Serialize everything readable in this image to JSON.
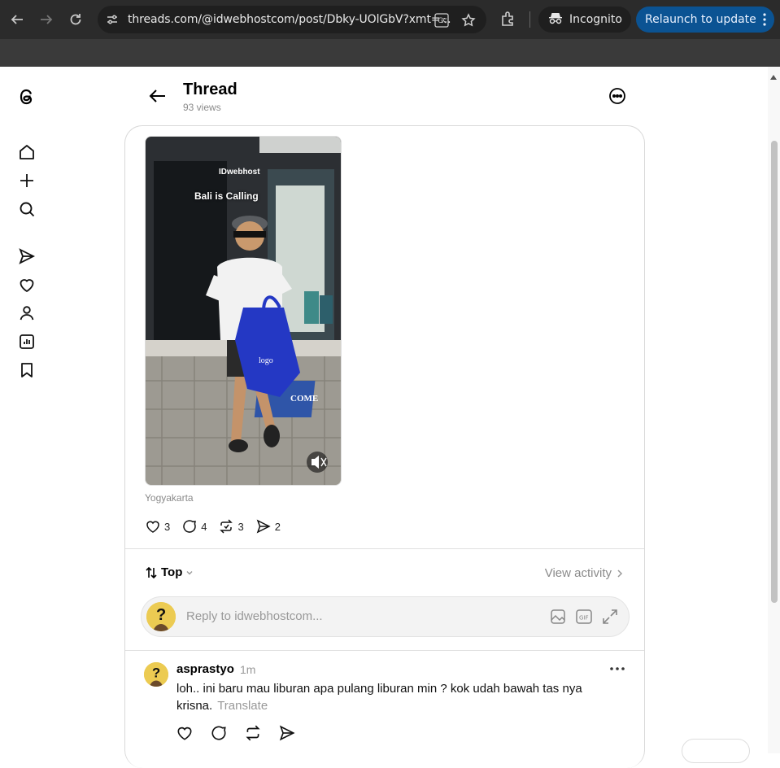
{
  "browser": {
    "url": "threads.com/@idwebhostcom/post/Dbky-UOlGbV?xmt=...",
    "incognito_label": "Incognito",
    "relaunch_label": "Relaunch to update"
  },
  "header": {
    "title": "Thread",
    "views": "93 views"
  },
  "post": {
    "video_overlay_brand": "IDwebhost",
    "video_overlay_caption": "Bali is Calling",
    "video_sign_text": "COME",
    "location": "Yogyakarta",
    "likes": "3",
    "replies": "4",
    "reposts": "3",
    "shares": "2"
  },
  "sort": {
    "label": "Top",
    "view_activity": "View activity"
  },
  "reply": {
    "placeholder": "Reply to idwebhostcom..."
  },
  "comment": {
    "author": "asprastyo",
    "time": "1m",
    "text": "loh.. ini baru mau liburan apa pulang liburan min ? kok udah bawah tas nya krisna.",
    "translate": "Translate"
  },
  "colors": {
    "relaunch_bg": "#0b5393",
    "chrome_bg": "#2b2b2b",
    "muted_text": "#8a8a8a"
  }
}
